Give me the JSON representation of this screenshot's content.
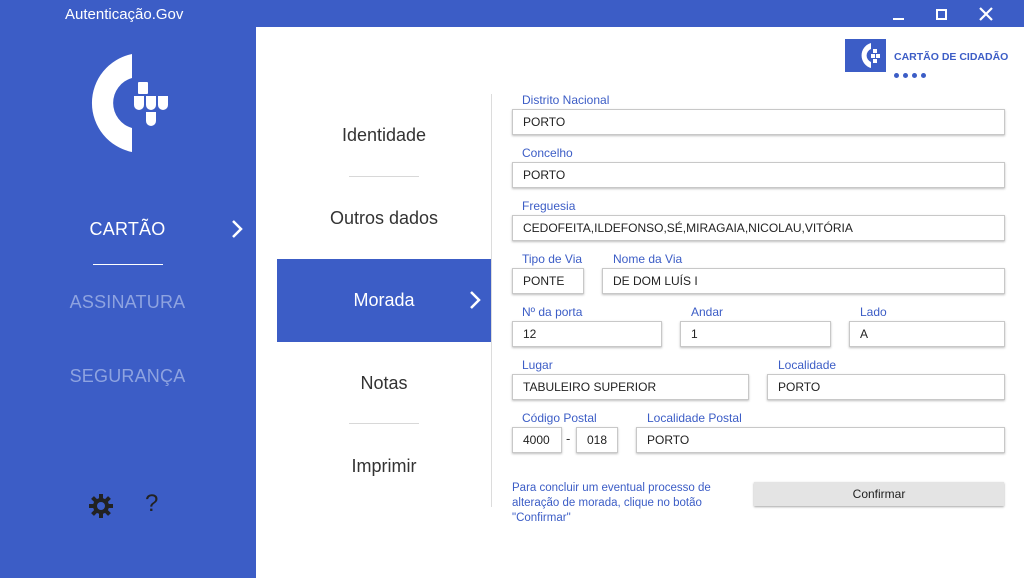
{
  "window": {
    "title": "Autenticação.Gov"
  },
  "sidebar": {
    "items": [
      {
        "label": "CARTÃO"
      },
      {
        "label": "ASSINATURA"
      },
      {
        "label": "SEGURANÇA"
      }
    ],
    "help_label": "?"
  },
  "badge": {
    "text": "CARTÃO DE CIDADÃO"
  },
  "menu": {
    "items": [
      {
        "label": "Identidade"
      },
      {
        "label": "Outros dados"
      },
      {
        "label": "Morada"
      },
      {
        "label": "Notas"
      },
      {
        "label": "Imprimir"
      }
    ]
  },
  "form": {
    "distrito_label": "Distrito Nacional",
    "distrito_value": "PORTO",
    "concelho_label": "Concelho",
    "concelho_value": "PORTO",
    "freguesia_label": "Freguesia",
    "freguesia_value": "CEDOFEITA,ILDEFONSO,SÉ,MIRAGAIA,NICOLAU,VITÓRIA",
    "tipo_via_label": "Tipo de Via",
    "tipo_via_value": "PONTE",
    "nome_via_label": "Nome da Via",
    "nome_via_value": "DE DOM LUÍS I",
    "porta_label": "Nº da porta",
    "porta_value": "12",
    "andar_label": "Andar",
    "andar_value": "1",
    "lado_label": "Lado",
    "lado_value": "A",
    "lugar_label": "Lugar",
    "lugar_value": "TABULEIRO SUPERIOR",
    "localidade_label": "Localidade",
    "localidade_value": "PORTO",
    "cp_label": "Código Postal",
    "cp4_value": "4000",
    "cp_dash": "-",
    "cp3_value": "018",
    "loc_postal_label": "Localidade Postal",
    "loc_postal_value": "PORTO"
  },
  "footer": {
    "note": "Para concluir um eventual processo de alteração de morada, clique no botão \"Confirmar\"",
    "confirm_label": "Confirmar"
  },
  "colors": {
    "brand_blue": "#3c5dc6",
    "inactive_text": "#8ea3e0",
    "panel_bg": "#ffffff"
  },
  "icons": [
    "logo-icon",
    "chevron-right-icon",
    "gear-icon",
    "minimize-icon",
    "maximize-icon",
    "close-icon"
  ]
}
